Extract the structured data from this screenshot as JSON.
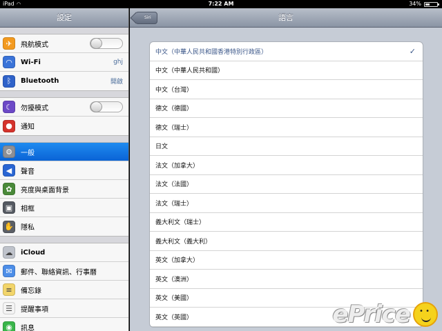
{
  "statusbar": {
    "carrier": "iPad",
    "time": "7:22 AM",
    "battery_pct": "34%",
    "battery_level": 0.34
  },
  "sidebar": {
    "title": "設定",
    "groups": [
      {
        "items": [
          {
            "label": "飛航模式",
            "icon": "airplane-icon",
            "icon_color": "#f39a1f",
            "toggle": "off"
          },
          {
            "label": "Wi-Fi",
            "icon": "wifi-icon",
            "icon_color": "#3a73d8",
            "value": "ghj"
          },
          {
            "label": "Bluetooth",
            "icon": "bluetooth-icon",
            "icon_color": "#2f62c9",
            "value": "開啟"
          }
        ]
      },
      {
        "items": [
          {
            "label": "勿擾模式",
            "icon": "moon-icon",
            "icon_color": "#6c49c7",
            "toggle": "off"
          },
          {
            "label": "通知",
            "icon": "notification-icon",
            "icon_color": "#d4332c"
          }
        ]
      },
      {
        "items": [
          {
            "label": "一般",
            "icon": "gear-icon",
            "icon_color": "#8d8f95",
            "selected": true
          },
          {
            "label": "聲音",
            "icon": "speaker-icon",
            "icon_color": "#2a66d3"
          },
          {
            "label": "亮度與桌面背景",
            "icon": "flower-icon",
            "icon_color": "#4a8a3a"
          },
          {
            "label": "相框",
            "icon": "frame-icon",
            "icon_color": "#555a62"
          },
          {
            "label": "隱私",
            "icon": "hand-icon",
            "icon_color": "#5b5f66"
          }
        ]
      },
      {
        "items": [
          {
            "label": "iCloud",
            "icon": "cloud-icon",
            "icon_color": "#bfc3cb"
          },
          {
            "label": "郵件、聯絡資訊、行事曆",
            "icon": "mail-icon",
            "icon_color": "#4d8ee8"
          },
          {
            "label": "備忘錄",
            "icon": "notes-icon",
            "icon_color": "#f2d56b"
          },
          {
            "label": "提醒事項",
            "icon": "reminders-icon",
            "icon_color": "#f4f4f4"
          },
          {
            "label": "訊息",
            "icon": "message-icon",
            "icon_color": "#39b54a"
          }
        ]
      }
    ]
  },
  "main": {
    "title": "語言",
    "back_label": "Siri",
    "languages": [
      {
        "label": "中文（中華人民共和國香港特別行政區）",
        "selected": true
      },
      {
        "label": "中文（中華人民共和國）"
      },
      {
        "label": "中文（台灣）"
      },
      {
        "label": "德文（德國）"
      },
      {
        "label": "德文（瑞士）"
      },
      {
        "label": "日文"
      },
      {
        "label": "法文（加拿大）"
      },
      {
        "label": "法文（法國）"
      },
      {
        "label": "法文（瑞士）"
      },
      {
        "label": "義大利文（瑞士）"
      },
      {
        "label": "義大利文（義大利）"
      },
      {
        "label": "英文（加拿大）"
      },
      {
        "label": "英文（澳洲）"
      },
      {
        "label": "英文（美國）"
      },
      {
        "label": "英文（英國）"
      }
    ],
    "checkmark": "✓"
  },
  "watermark": {
    "text": "ePrice"
  },
  "colors": {
    "selected_row": "#0a63d6",
    "selected_language_text": "#385487",
    "value_text": "#4a6c9a"
  }
}
